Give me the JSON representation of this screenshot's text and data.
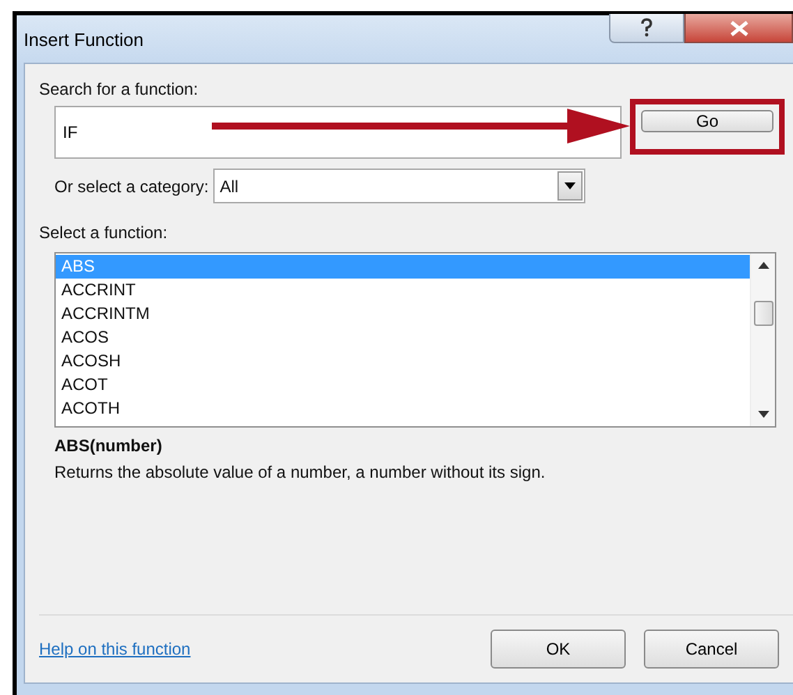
{
  "window": {
    "title": "Insert Function"
  },
  "search": {
    "label": "Search for a function:",
    "value": "IF",
    "go_button": {
      "label": "Go",
      "highlighted": true
    }
  },
  "category": {
    "label": "Or select a category:",
    "value": "All"
  },
  "functions": {
    "label": "Select a function:",
    "items": [
      {
        "name": "ABS",
        "selected": true
      },
      {
        "name": "ACCRINT",
        "selected": false
      },
      {
        "name": "ACCRINTM",
        "selected": false
      },
      {
        "name": "ACOS",
        "selected": false
      },
      {
        "name": "ACOSH",
        "selected": false
      },
      {
        "name": "ACOT",
        "selected": false
      },
      {
        "name": "ACOTH",
        "selected": false
      }
    ]
  },
  "syntax": "ABS(number)",
  "description": "Returns the absolute value of a number, a number without its sign.",
  "help_link": "Help on this function",
  "buttons": [
    "OK",
    "Cancel"
  ]
}
